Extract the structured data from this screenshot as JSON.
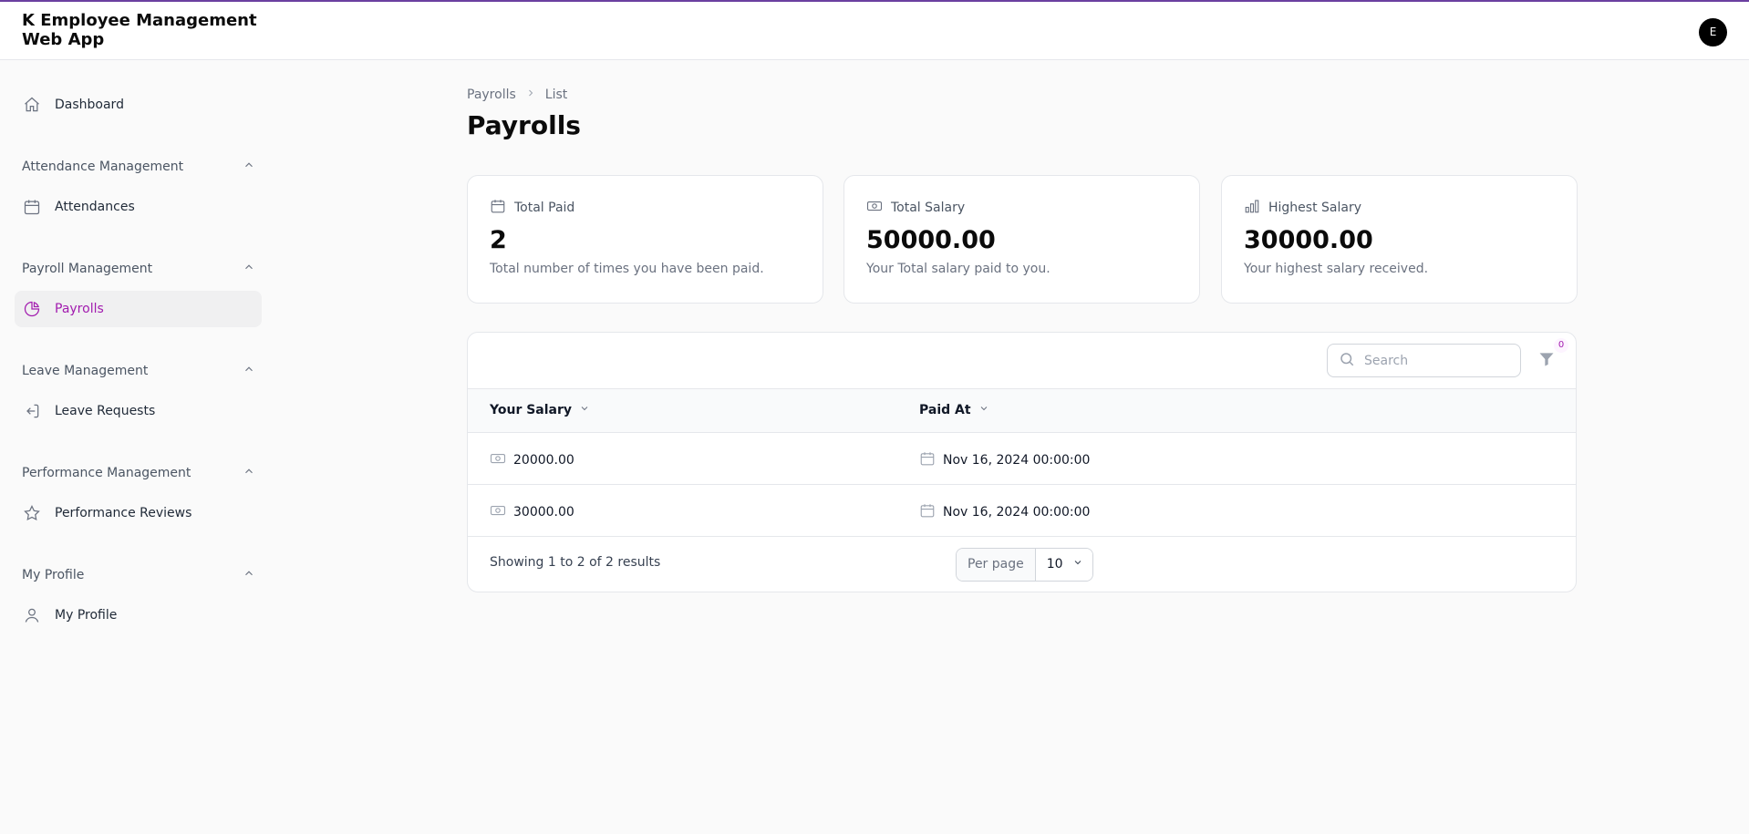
{
  "app": {
    "title": "K Employee Management Web App",
    "avatar_initial": "E"
  },
  "sidebar": {
    "dashboard": "Dashboard",
    "groups": [
      {
        "label": "Attendance Management",
        "item": "Attendances"
      },
      {
        "label": "Payroll Management",
        "item": "Payrolls"
      },
      {
        "label": "Leave Management",
        "item": "Leave Requests"
      },
      {
        "label": "Performance Management",
        "item": "Performance Reviews"
      },
      {
        "label": "My Profile",
        "item": "My Profile"
      }
    ],
    "active_item": "Payrolls"
  },
  "breadcrumb": {
    "parent": "Payrolls",
    "current": "List"
  },
  "page_title": "Payrolls",
  "stats": [
    {
      "label": "Total Paid",
      "value": "2",
      "description": "Total number of times you have been paid.",
      "icon": "calendar-icon"
    },
    {
      "label": "Total Salary",
      "value": "50000.00",
      "description": "Your Total salary paid to you.",
      "icon": "banknote-icon"
    },
    {
      "label": "Highest Salary",
      "value": "30000.00",
      "description": "Your highest salary received.",
      "icon": "bar-chart-icon"
    }
  ],
  "table": {
    "search_placeholder": "Search",
    "filter_count": "0",
    "columns": [
      "Your Salary",
      "Paid At"
    ],
    "rows": [
      {
        "salary": "20000.00",
        "paid_at": "Nov 16, 2024 00:00:00"
      },
      {
        "salary": "30000.00",
        "paid_at": "Nov 16, 2024 00:00:00"
      }
    ],
    "summary": "Showing 1 to 2 of 2 results",
    "per_page_label": "Per page",
    "per_page_value": "10"
  },
  "colors": {
    "accent": "#a21caf",
    "topbar_border": "#6b3fa0"
  }
}
